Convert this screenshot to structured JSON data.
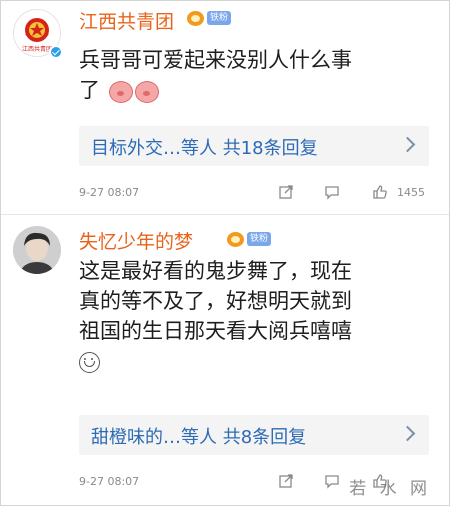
{
  "comments": [
    {
      "username": "江西共青团",
      "badge": "铁粉",
      "avatar_label": "江西共青团",
      "verified": true,
      "lines": [
        "兵哥哥可爱起来没别人什么事",
        "了"
      ],
      "emoji": [
        "pig-face",
        "pig-face"
      ],
      "replies_label": "目标外交…等人  共18条回复",
      "time": "9-27 08:07",
      "likes": "1455"
    },
    {
      "username": "失忆少年的梦",
      "badge": "铁粉",
      "lines": [
        "这是最好看的鬼步舞了，现在",
        "真的等不及了，好想明天就到",
        "祖国的生日那天看大阅兵嘻嘻"
      ],
      "emoji": [
        "smile"
      ],
      "replies_label": "甜橙味的…等人  共8条回复",
      "time": "9-27 08:07",
      "likes": ""
    }
  ],
  "watermark": "若 水 网",
  "colors": {
    "username": "#e8641b",
    "link": "#2d6bb5",
    "meta": "#8a8a8a",
    "reply_bg": "#f4f4f4",
    "verified": "#2aa1ea"
  },
  "icons": [
    "share-icon",
    "comment-icon",
    "like-icon",
    "chevron-right-icon",
    "crown-badge-icon"
  ]
}
